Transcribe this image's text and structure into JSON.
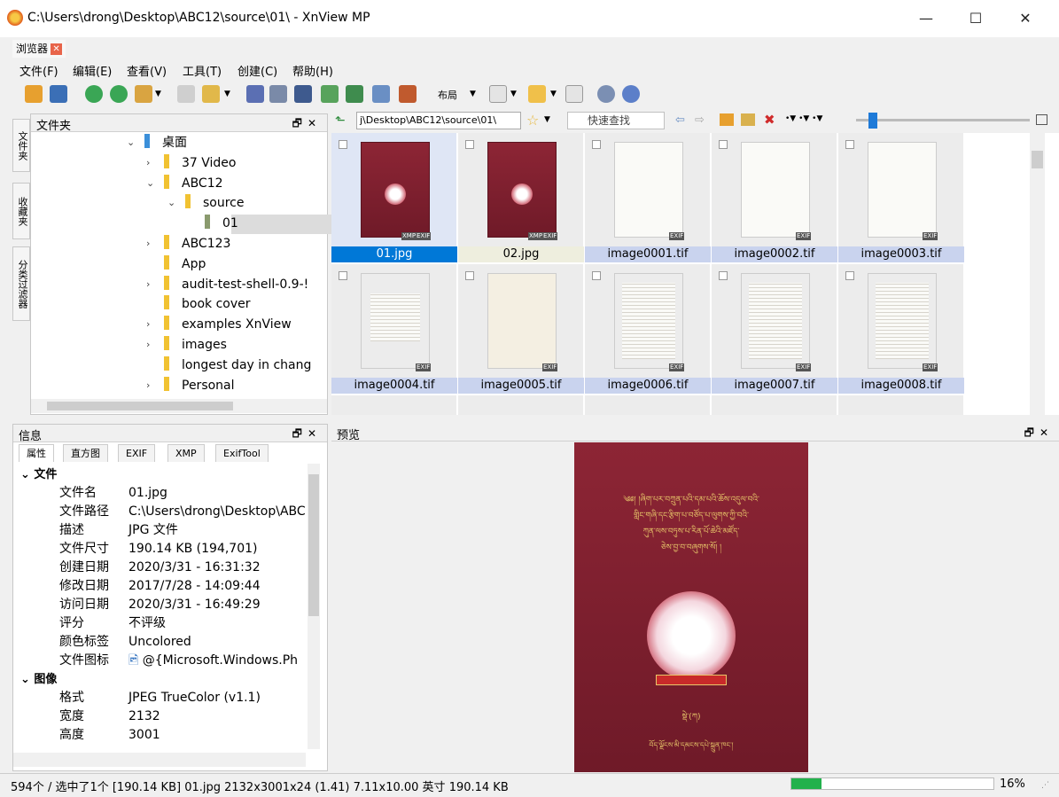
{
  "window": {
    "title": "C:\\Users\\drong\\Desktop\\ABC12\\source\\01\\ - XnView MP"
  },
  "tab": {
    "label": "浏览器"
  },
  "menu": [
    "文件(F)",
    "编辑(E)",
    "查看(V)",
    "工具(T)",
    "创建(C)",
    "帮助(H)"
  ],
  "toolbar": {
    "layout_label": "布局"
  },
  "folder_panel": {
    "title": "文件夹",
    "side_tabs": [
      "文件夹",
      "收藏夹",
      "分类过滤器"
    ],
    "tree": [
      {
        "label": "桌面",
        "level": 0,
        "expanded": true
      },
      {
        "label": "37 Video",
        "level": 1,
        "expanded": false
      },
      {
        "label": "ABC12",
        "level": 1,
        "expanded": true
      },
      {
        "label": "source",
        "level": 2,
        "expanded": true
      },
      {
        "label": "01",
        "level": 3,
        "selected": true
      },
      {
        "label": "ABC123",
        "level": 1,
        "expanded": false
      },
      {
        "label": "App",
        "level": 1
      },
      {
        "label": "audit-test-shell-0.9-!",
        "level": 1,
        "expanded": false
      },
      {
        "label": "book cover",
        "level": 1
      },
      {
        "label": "examples XnView",
        "level": 1,
        "expanded": false
      },
      {
        "label": "images",
        "level": 1,
        "expanded": false
      },
      {
        "label": "longest day in chang",
        "level": 1
      },
      {
        "label": "Personal",
        "level": 1,
        "expanded": false
      }
    ]
  },
  "pathbar": {
    "path": "j\\Desktop\\ABC12\\source\\01\\",
    "search_placeholder": "快速查找"
  },
  "thumbnails": [
    {
      "name": "01.jpg",
      "selected": true,
      "kind": "red",
      "badges": [
        "XMP",
        "EXIF"
      ]
    },
    {
      "name": "02.jpg",
      "kind": "red",
      "badges": [
        "XMP",
        "EXIF"
      ]
    },
    {
      "name": "image0001.tif",
      "kind": "blank",
      "badges": [
        "EXIF"
      ]
    },
    {
      "name": "image0002.tif",
      "kind": "title",
      "badges": [
        "EXIF"
      ]
    },
    {
      "name": "image0003.tif",
      "kind": "blank",
      "badges": [
        "EXIF"
      ]
    },
    {
      "name": "image0004.tif",
      "kind": "toc",
      "badges": [
        "EXIF"
      ]
    },
    {
      "name": "image0005.tif",
      "kind": "faded",
      "badges": [
        "EXIF"
      ]
    },
    {
      "name": "image0006.tif",
      "kind": "text",
      "badges": [
        "EXIF"
      ]
    },
    {
      "name": "image0007.tif",
      "kind": "text",
      "badges": [
        "EXIF"
      ]
    },
    {
      "name": "image0008.tif",
      "kind": "text",
      "badges": [
        "EXIF"
      ]
    }
  ],
  "info_panel": {
    "title": "信息",
    "tabs": [
      "属性",
      "直方图",
      "EXIF",
      "XMP",
      "ExifTool"
    ],
    "groups": [
      {
        "name": "文件",
        "rows": [
          {
            "key": "文件名",
            "value": "01.jpg"
          },
          {
            "key": "文件路径",
            "value": "C:\\Users\\drong\\Desktop\\ABC"
          },
          {
            "key": "描述",
            "value": "JPG 文件"
          },
          {
            "key": "文件尺寸",
            "value": "190.14 KB (194,701)"
          },
          {
            "key": "创建日期",
            "value": "2020/3/31 - 16:31:32"
          },
          {
            "key": "修改日期",
            "value": "2017/7/28 - 14:09:44"
          },
          {
            "key": "访问日期",
            "value": "2020/3/31 - 16:49:29"
          },
          {
            "key": "评分",
            "value": "不评级"
          },
          {
            "key": "颜色标签",
            "value": "Uncolored"
          },
          {
            "key": "文件图标",
            "value": "@{Microsoft.Windows.Ph"
          }
        ]
      },
      {
        "name": "图像",
        "rows": [
          {
            "key": "格式",
            "value": "JPEG TrueColor (v1.1)"
          },
          {
            "key": "宽度",
            "value": "2132"
          },
          {
            "key": "高度",
            "value": "3001"
          }
        ]
      }
    ]
  },
  "preview_panel": {
    "title": "预览",
    "cover_lines": [
      "༄༅། །ཞིག་པར་བཀྲུན་པའི་དམ་པའི་ཆོས་འདུལ་བའི་",
      "གླིང་གཞི་དང་རྩིག་པ་བཙོད་པ་ལུགས་ཀྱི་བའི་",
      "ཀུན་ལས་བཏུས་པ་རིན་པོ་ཆེའི་མཛོད་",
      "ཅེས་བྱ་བ་བཞུགས་སོ། །"
    ],
    "cover_sub": "སྡེ་(ཀ)",
    "cover_footer": "བོད་ལྗོངས་མི་དམངས་དཔེ་སྐྲུན་ཁང་།"
  },
  "status": {
    "text": "594个 / 选中了1个 [190.14 KB]  01.jpg  2132x3001x24 (1.41)  7.11x10.00 英寸  190.14 KB",
    "progress": 0.15,
    "zoom": "16%"
  },
  "colors": {
    "selection": "#0078d7",
    "label_bg": "#c9d3ee",
    "cover": "#8d2535",
    "cover_text": "#e8c76a"
  }
}
